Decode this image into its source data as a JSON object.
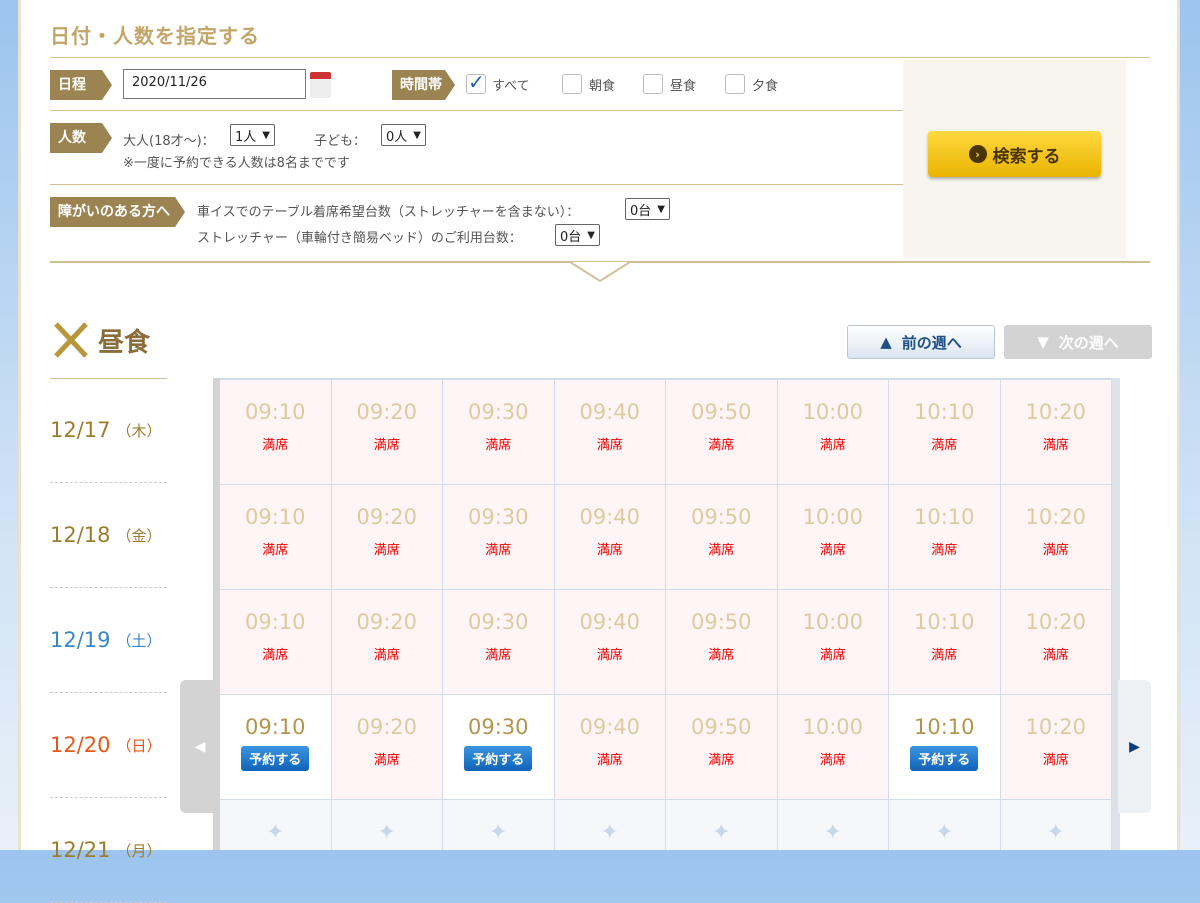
{
  "form": {
    "title": "日付・人数を指定する",
    "schedule_label": "日程",
    "date_value": "2020/11/26",
    "timeslot_label": "時間帯",
    "timeslots": [
      {
        "label": "すべて",
        "checked": true
      },
      {
        "label": "朝食",
        "checked": false
      },
      {
        "label": "昼食",
        "checked": false
      },
      {
        "label": "夕食",
        "checked": false
      }
    ],
    "people_label": "人数",
    "adult_label": "大人(18才～)：",
    "adult_value": "1人",
    "child_label": "子ども：",
    "child_value": "0人",
    "people_note": "※一度に予約できる人数は8名までです",
    "disability_label": "障がいのある方へ",
    "wheelchair_label": "車イスでのテーブル着席希望台数（ストレッチャーを含まない）：",
    "wheelchair_value": "0台",
    "stretcher_label": "ストレッチャー（車輪付き簡易ベッド）のご利用台数：",
    "stretcher_value": "0台",
    "search_label": "検索する"
  },
  "meal": {
    "title": "昼食",
    "prev_week": "前の週へ",
    "next_week": "次の週へ"
  },
  "colors": {
    "weekday": "#9c7d2e",
    "saturday": "#3a86c8",
    "sunday": "#e8561a"
  },
  "times": [
    "09:10",
    "09:20",
    "09:30",
    "09:40",
    "09:50",
    "10:00",
    "10:10",
    "10:20"
  ],
  "full_label": "満席",
  "reserve_label": "予約する",
  "days": [
    {
      "date": "12/17",
      "dow": "（木）",
      "type": "weekday",
      "slots": [
        "full",
        "full",
        "full",
        "full",
        "full",
        "full",
        "full",
        "full"
      ]
    },
    {
      "date": "12/18",
      "dow": "（金）",
      "type": "weekday",
      "slots": [
        "full",
        "full",
        "full",
        "full",
        "full",
        "full",
        "full",
        "full"
      ]
    },
    {
      "date": "12/19",
      "dow": "（土）",
      "type": "saturday",
      "slots": [
        "full",
        "full",
        "full",
        "full",
        "full",
        "full",
        "full",
        "full"
      ]
    },
    {
      "date": "12/20",
      "dow": "（日）",
      "type": "sunday",
      "slots": [
        "open",
        "full",
        "open",
        "full",
        "full",
        "full",
        "open",
        "full"
      ]
    },
    {
      "date": "12/21",
      "dow": "（月）",
      "type": "weekday",
      "slots": [
        "empty",
        "empty",
        "empty",
        "empty",
        "empty",
        "empty",
        "empty",
        "empty"
      ]
    }
  ]
}
